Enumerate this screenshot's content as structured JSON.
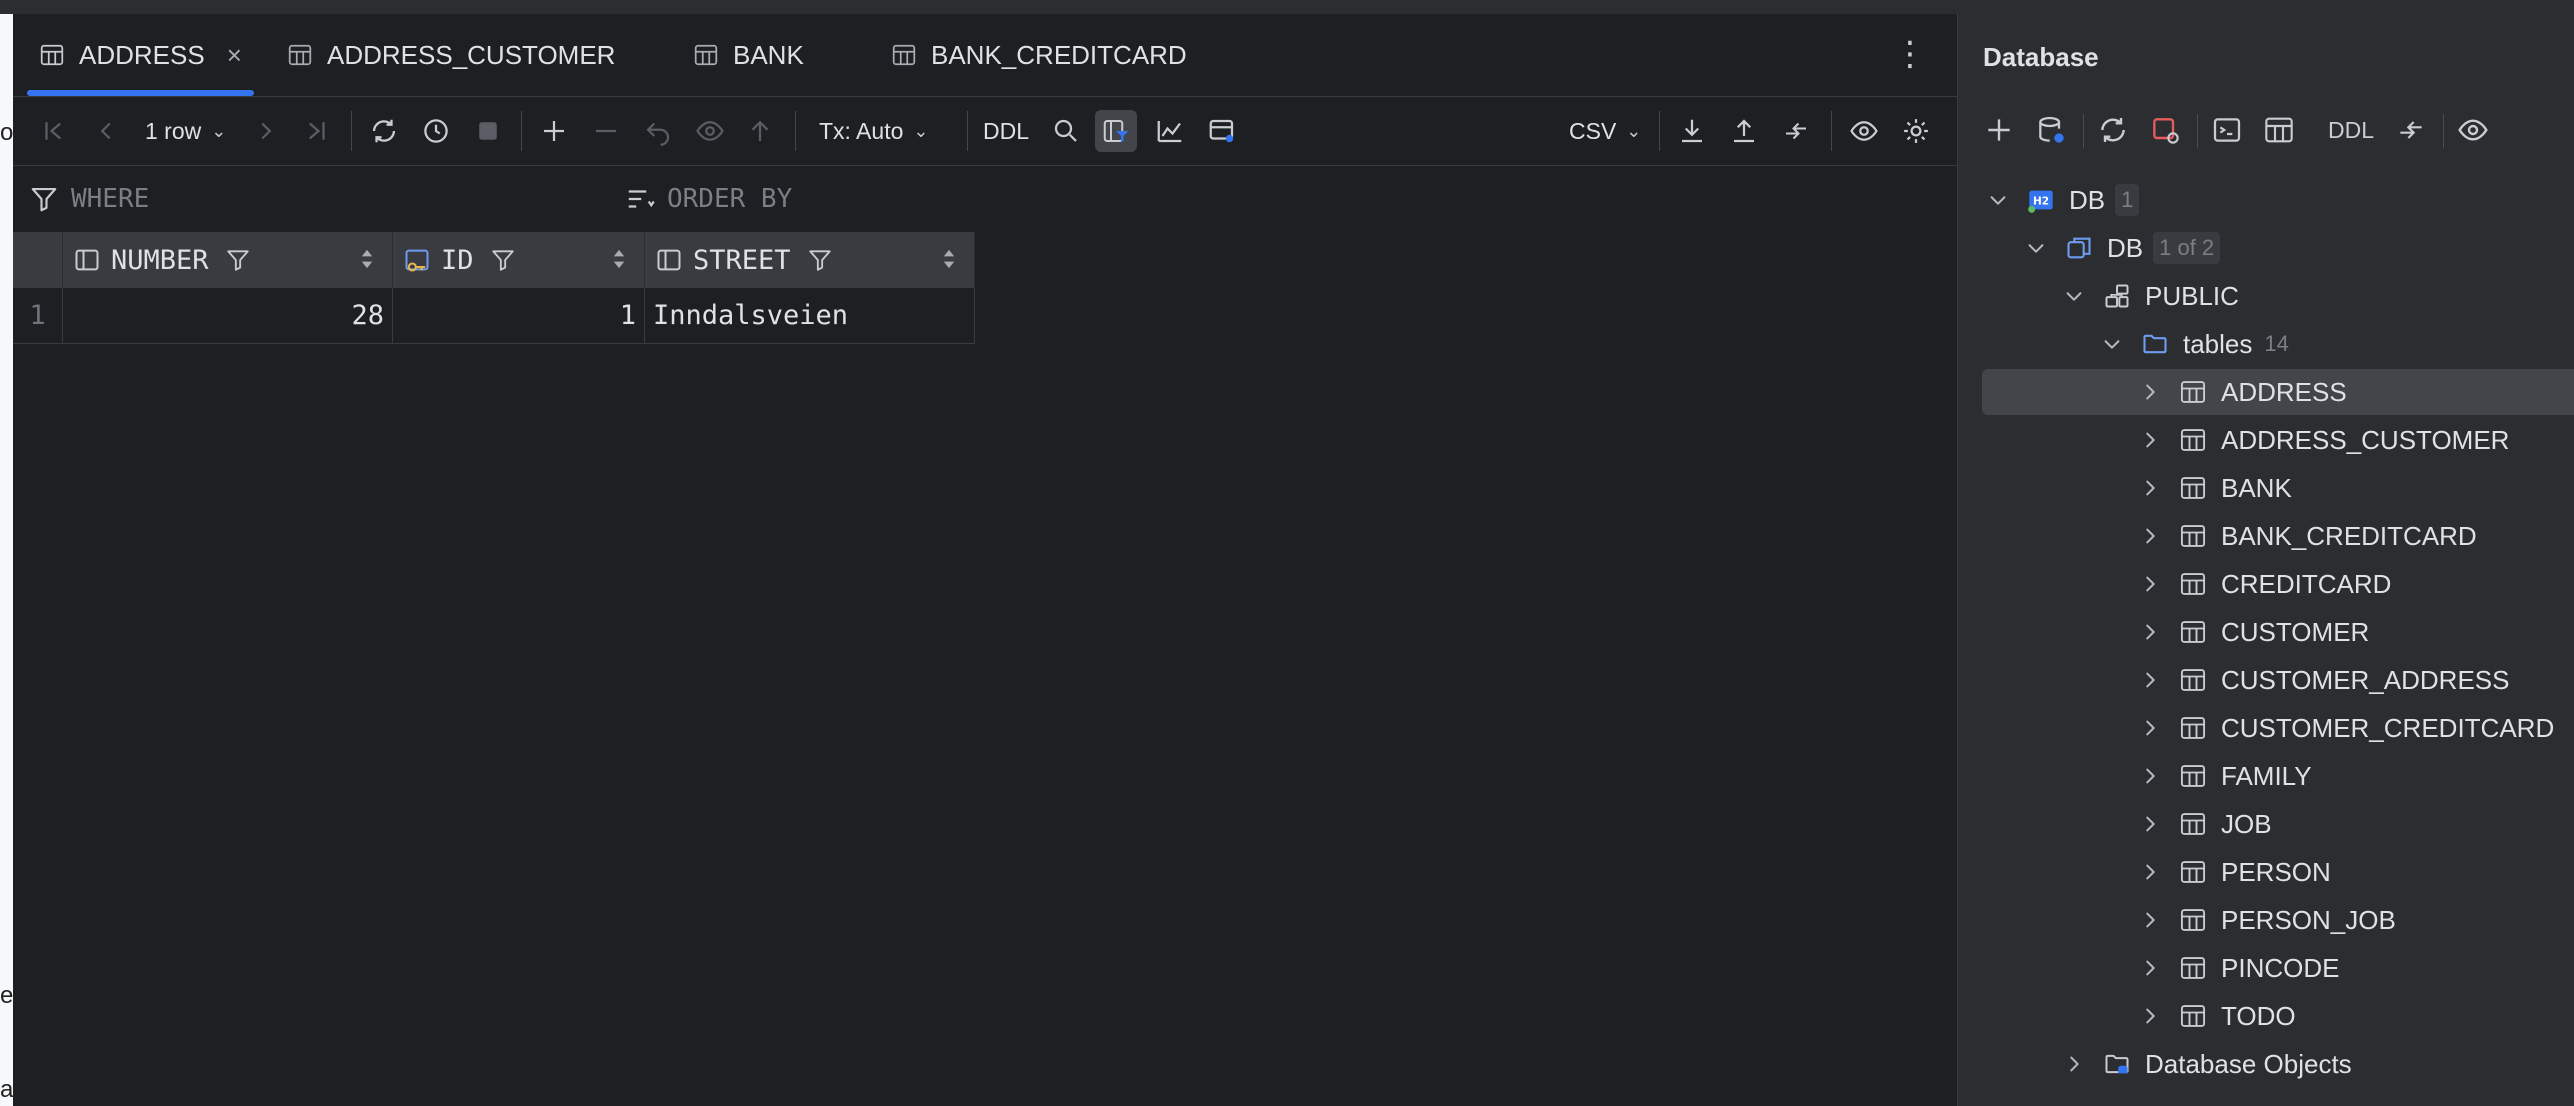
{
  "tabs": [
    {
      "label": "ADDRESS",
      "close": "×"
    },
    {
      "label": "ADDRESS_CUSTOMER"
    },
    {
      "label": "BANK"
    },
    {
      "label": "BANK_CREDITCARD"
    }
  ],
  "toolbar": {
    "rows_label": "1 row",
    "tx_label": "Tx: Auto",
    "ddl_label": "DDL",
    "export_format": "CSV"
  },
  "filters": {
    "where_placeholder": "WHERE",
    "order_placeholder": "ORDER BY"
  },
  "grid": {
    "columns": [
      "NUMBER",
      "ID",
      "STREET"
    ],
    "rows": [
      {
        "rownum": "1",
        "number": "28",
        "id": "1",
        "street": "Inndalsveien"
      }
    ]
  },
  "sidebar": {
    "title": "Database",
    "ddl_label": "DDL",
    "tree": {
      "root": {
        "label": "DB",
        "badge": "1"
      },
      "db": {
        "label": "DB",
        "badge": "1 of 2"
      },
      "schema": {
        "label": "PUBLIC"
      },
      "tables_folder": {
        "label": "tables",
        "count": "14"
      },
      "tables": [
        "ADDRESS",
        "ADDRESS_CUSTOMER",
        "BANK",
        "BANK_CREDITCARD",
        "CREDITCARD",
        "CUSTOMER",
        "CUSTOMER_ADDRESS",
        "CUSTOMER_CREDITCARD",
        "FAMILY",
        "JOB",
        "PERSON",
        "PERSON_JOB",
        "PINCODE",
        "TODO"
      ],
      "db_objects": {
        "label": "Database Objects"
      }
    }
  },
  "left_edge": {
    "glyph_top": "o",
    "glyph_mid": "e",
    "glyph_bottom": "a"
  },
  "icons": {
    "table": "table-icon",
    "close": "close-icon",
    "more": "more-vertical-icon",
    "filter": "filter-icon",
    "sort": "sort-icon",
    "key": "primary-key-icon"
  },
  "colors": {
    "accent": "#3574f0",
    "background": "#1e1f22",
    "panel": "#2b2d30",
    "selection": "#43454a"
  }
}
